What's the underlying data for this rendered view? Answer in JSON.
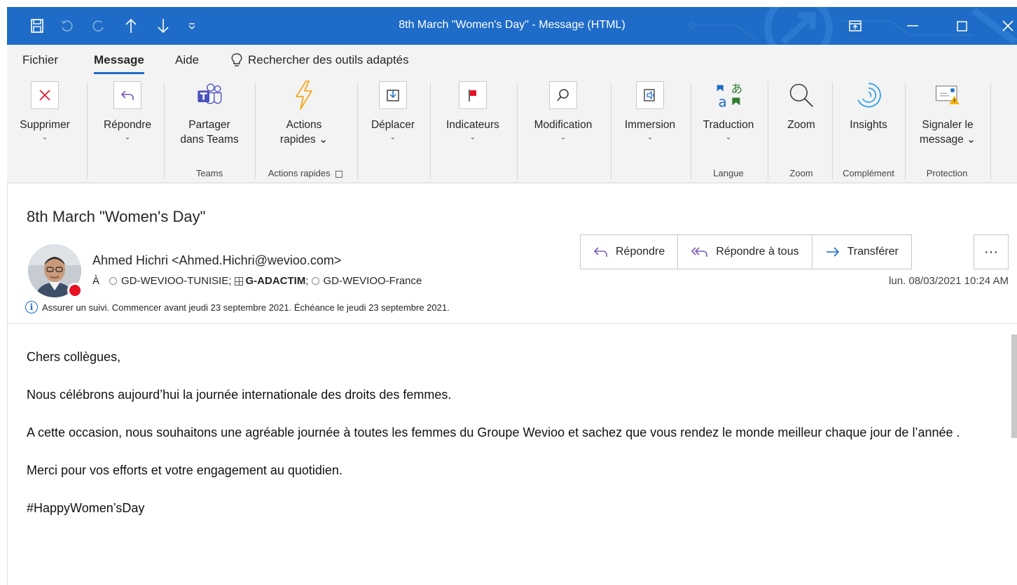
{
  "window": {
    "title": "8th March \"Women's Day\"  -  Message (HTML)"
  },
  "tabs": {
    "file": "Fichier",
    "message": "Message",
    "help": "Aide",
    "search": "Rechercher des outils adaptés"
  },
  "ribbon": {
    "delete": {
      "label": "Supprimer",
      "chevron": "⌄"
    },
    "reply": {
      "label": "Répondre",
      "chevron": "⌄"
    },
    "teams": {
      "line1": "Partager",
      "line2": "dans Teams"
    },
    "quick": {
      "line1": "Actions",
      "line2": "rapides ⌄"
    },
    "move": {
      "label": "Déplacer",
      "chevron": "⌄"
    },
    "tags": {
      "label": "Indicateurs",
      "chevron": "⌄"
    },
    "edit": {
      "label": "Modification",
      "chevron": "⌄"
    },
    "immersive": {
      "label": "Immersion",
      "chevron": "⌄"
    },
    "translate": {
      "label": "Traduction",
      "chevron": "⌄"
    },
    "zoom": {
      "label": "Zoom"
    },
    "insights": {
      "label": "Insights"
    },
    "report": {
      "line1": "Signaler le",
      "line2": "message ⌄"
    },
    "groups": {
      "teams": "Teams",
      "quick": "Actions rapides",
      "language": "Langue",
      "zoom": "Zoom",
      "addin": "Complément",
      "protection": "Protection"
    }
  },
  "message": {
    "subject": "8th March \"Women's Day\"",
    "sender": "Ahmed Hichri <Ahmed.Hichri@wevioo.com>",
    "to_label": "À",
    "recipients": [
      "GD-WEVIOO-TUNISIE;",
      "G-ADACTIM",
      ";",
      "GD-WEVIOO-France"
    ],
    "datetime": "lun. 08/03/2021 10:24 AM",
    "info": "Assurer un suivi.  Commencer avant jeudi 23 septembre 2021.  Échéance le jeudi 23 septembre 2021.",
    "actions": {
      "reply": "Répondre",
      "reply_all": "Répondre à tous",
      "forward": "Transférer",
      "more": "···"
    },
    "body": [
      "Chers collègues,",
      "Nous célébrons aujourd’hui la journée internationale des droits des femmes.",
      "A cette occasion, nous souhaitons une agréable journée à toutes les femmes du Groupe Wevioo et sachez que vous rendez le monde meilleur chaque jour de l’année .",
      "Merci pour vos efforts et votre engagement au quotidien.",
      "#HappyWomen’sDay"
    ]
  },
  "colors": {
    "titlebar": "#1e6cc7",
    "accent": "#1e6cc7",
    "delete_red": "#e81123",
    "presence_busy": "#e81123"
  }
}
